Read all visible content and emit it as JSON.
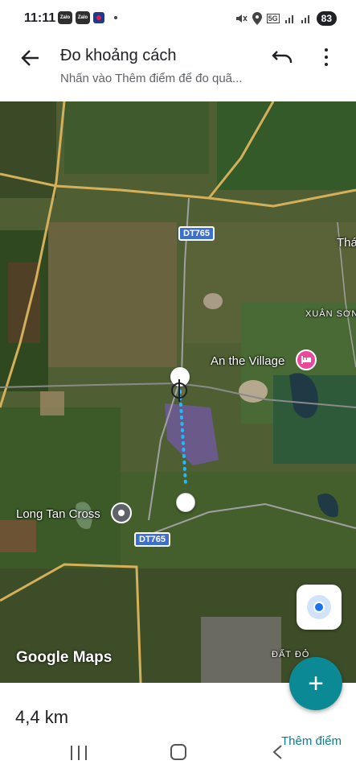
{
  "status_bar": {
    "time": "11:11",
    "notif1": "Zalo",
    "notif2": "Zalo",
    "network": "5G",
    "battery": "83"
  },
  "app_bar": {
    "title": "Đo khoảng cách",
    "subtitle": "Nhấn vào Thêm điểm để đo quã..."
  },
  "map": {
    "road1": "DT765",
    "road2": "DT765",
    "place_thai": "Thá",
    "place_xuan_son": "XUÂN SƠN",
    "poi_village": "An the Village",
    "poi_longtan": "Long Tan Cross",
    "place_dat_do": "ĐẤT ĐỎ",
    "logo": "Google Maps"
  },
  "bottom": {
    "distance": "4,4 km",
    "add_point": "Thêm điểm",
    "fab_symbol": "+"
  },
  "colors": {
    "accent": "#0b8a96",
    "route": "#29b6f6",
    "shield": "#3b6fd0",
    "hotel_pin": "#ec4899"
  },
  "icons": [
    "back-arrow-icon",
    "undo-icon",
    "more-vert-icon",
    "my-location-icon",
    "add-icon",
    "hotel-icon",
    "pin-icon"
  ]
}
